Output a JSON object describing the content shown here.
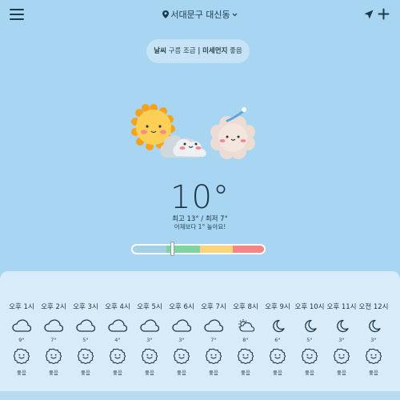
{
  "header": {
    "location": "서대문구 대신동",
    "menu_icon": "hamburger-menu-icon",
    "pin_icon": "map-pin-icon",
    "dropdown_icon": "chevron-down-icon",
    "location_arrow_icon": "location-arrow-icon",
    "add_icon": "plus-icon"
  },
  "summary_pill": {
    "weather_label": "날씨",
    "weather_value": "구름 조금",
    "separator": "|",
    "dust_label": "미세먼지",
    "dust_value": "좋음"
  },
  "current": {
    "temperature": "10°",
    "high_low": "최고 13° / 최저 7°",
    "comparison": "어제보다 1° 높아요!"
  },
  "air_quality_scale": {
    "level_fraction": 0.3,
    "colors": [
      "#a3cfe9",
      "#7fd4a0",
      "#fcd57b",
      "#f78585"
    ]
  },
  "hourly": [
    {
      "time": "오후 1시",
      "icon": "cloud-icon",
      "temp": "9°",
      "air": "좋음"
    },
    {
      "time": "오후 2시",
      "icon": "cloud-icon",
      "temp": "7°",
      "air": "좋음"
    },
    {
      "time": "오후 3시",
      "icon": "cloud-icon",
      "temp": "5°",
      "air": "좋음"
    },
    {
      "time": "오후 4시",
      "icon": "cloud-icon",
      "temp": "4°",
      "air": "좋음"
    },
    {
      "time": "오후 5시",
      "icon": "cloud-icon",
      "temp": "3°",
      "air": "좋음"
    },
    {
      "time": "오후 6시",
      "icon": "cloud-icon",
      "temp": "3°",
      "air": "좋음"
    },
    {
      "time": "오후 7시",
      "icon": "cloud-icon",
      "temp": "7°",
      "air": "좋음"
    },
    {
      "time": "오후 8시",
      "icon": "sun-cloud-icon",
      "temp": "8°",
      "air": "좋음"
    },
    {
      "time": "오후 9시",
      "icon": "moon-icon",
      "temp": "6°",
      "air": "좋음"
    },
    {
      "time": "오후 10시",
      "icon": "moon-icon",
      "temp": "5°",
      "air": "좋음"
    },
    {
      "time": "오후 11시",
      "icon": "moon-icon",
      "temp": "3°",
      "air": "좋음"
    },
    {
      "time": "오전 12시",
      "icon": "moon-icon",
      "temp": "3°",
      "air": "좋음"
    }
  ]
}
